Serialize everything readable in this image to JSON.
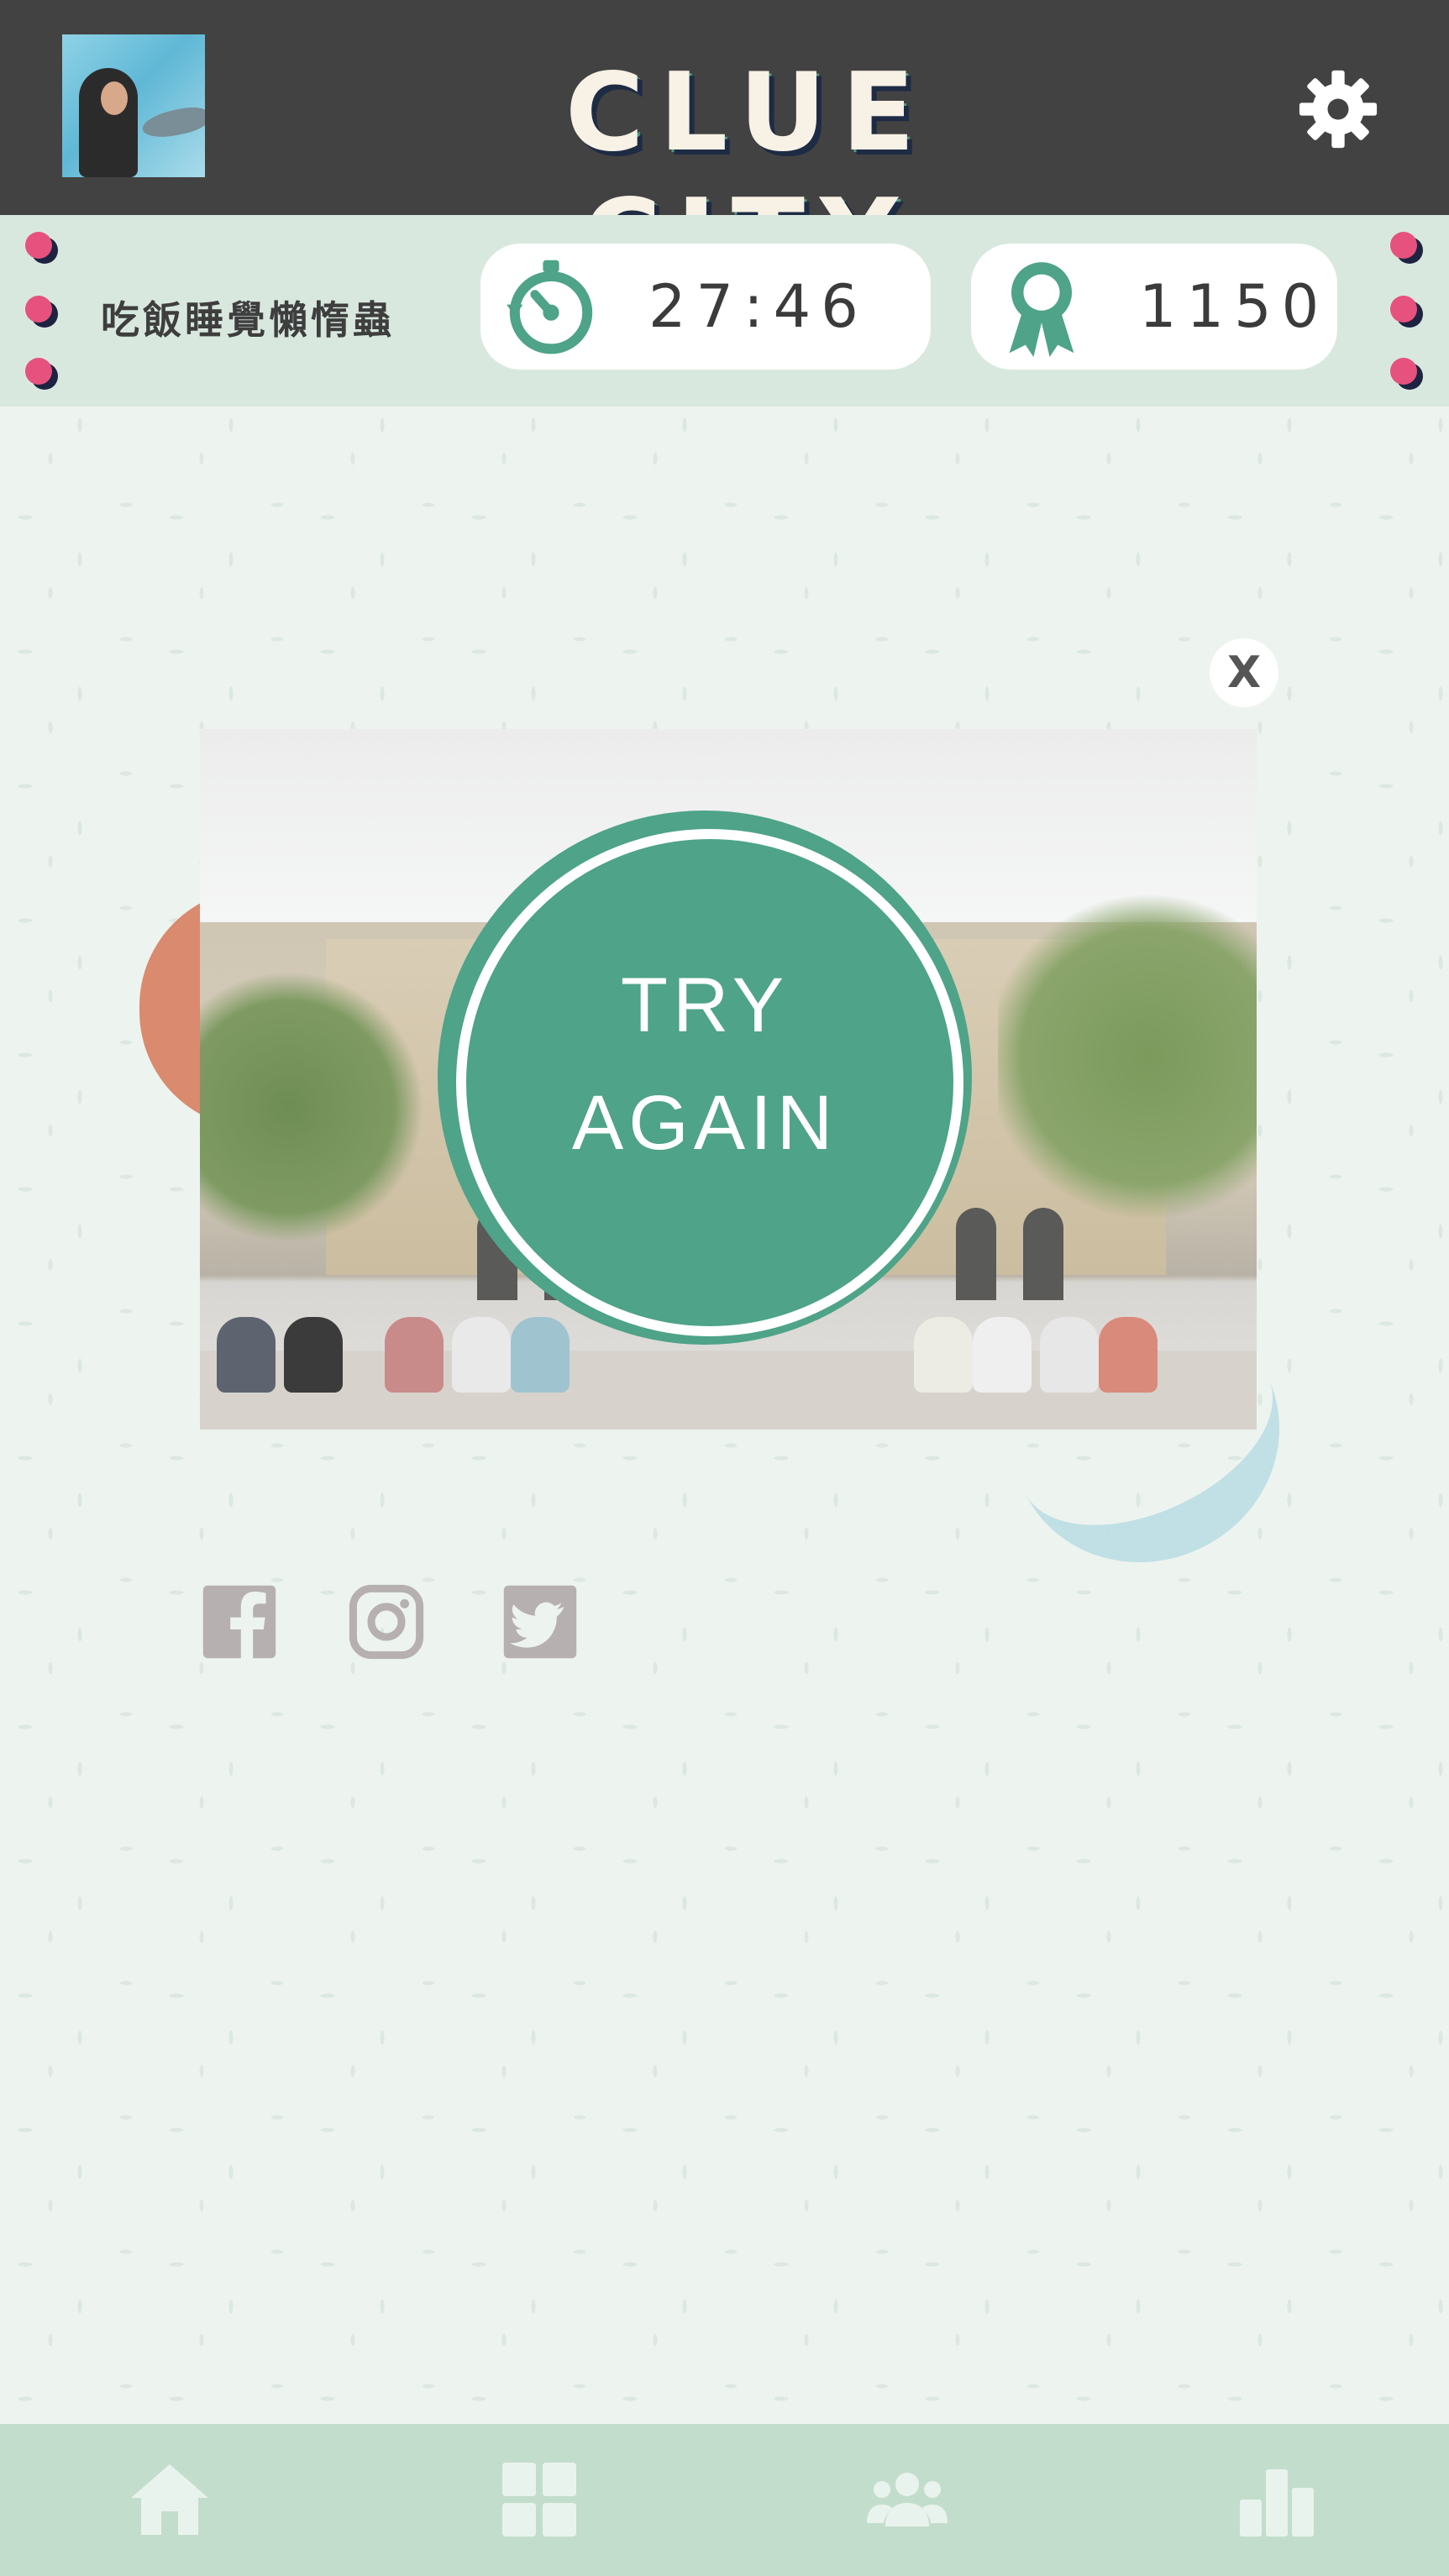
{
  "header": {
    "title": "CLUE CITY",
    "avatar_icon": "user-avatar",
    "settings_icon": "gear-icon"
  },
  "status": {
    "username": "吃飯睡覺懶惰蟲",
    "timer": "27:46",
    "timer_icon": "stopwatch-icon",
    "score": "1150",
    "score_icon": "award-ribbon-icon"
  },
  "modal": {
    "close_label": "X",
    "button_line1": "TRY",
    "button_line2": "AGAIN"
  },
  "share": {
    "icons": [
      "facebook-icon",
      "instagram-icon",
      "twitter-icon"
    ]
  },
  "bottom_nav": {
    "icons": [
      "home-icon",
      "grid-icon",
      "group-icon",
      "leaderboard-icon"
    ]
  },
  "colors": {
    "header_bg": "#424242",
    "accent_green": "#4ea388",
    "accent_pink": "#e6517e",
    "accent_navy": "#1d2340",
    "nav_bg": "#c3ddcc",
    "page_bg": "#edf3ef"
  }
}
